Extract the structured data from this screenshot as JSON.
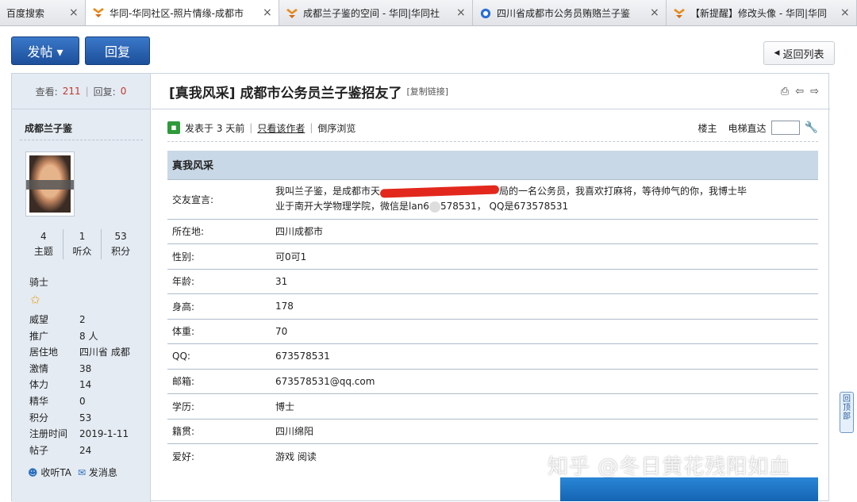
{
  "tabs": [
    {
      "title": "百度搜索",
      "active": false
    },
    {
      "title": "华同-华同社区-照片情缘-成都市",
      "active": true
    },
    {
      "title": "成都兰子鉴的空间 - 华同|华同社",
      "active": false
    },
    {
      "title": "四川省成都市公务员贿赂兰子鉴",
      "active": false
    },
    {
      "title": "【新提醒】修改头像 - 华同|华同",
      "active": false
    }
  ],
  "toolbar": {
    "post_label": "发帖 ▾",
    "reply_label": "回复",
    "back_label": "返回列表"
  },
  "sidebar": {
    "views_label": "查看:",
    "views_value": "211",
    "replies_label": "回复:",
    "replies_value": "0",
    "username": "成都兰子鉴",
    "stats": [
      {
        "value": "4",
        "label": "主题"
      },
      {
        "value": "1",
        "label": "听众"
      },
      {
        "value": "53",
        "label": "积分"
      }
    ],
    "rank": "骑士",
    "fields": [
      {
        "k": "威望",
        "v": "2"
      },
      {
        "k": "推广",
        "v": "8 人"
      },
      {
        "k": "居住地",
        "v": "四川省 成都"
      },
      {
        "k": "激情",
        "v": "38"
      },
      {
        "k": "体力",
        "v": "14"
      },
      {
        "k": "精华",
        "v": "0"
      },
      {
        "k": "积分",
        "v": "53"
      },
      {
        "k": "注册时间",
        "v": "2019-1-11"
      },
      {
        "k": "帖子",
        "v": "24"
      }
    ],
    "follow_label": "收听TA",
    "message_label": "发消息"
  },
  "post": {
    "title": "[真我风采] 成都市公务员兰子鉴招友了",
    "copy_label": "[复制链接]",
    "posted_label": "发表于 3 天前",
    "only_author_label": "只看该作者",
    "reverse_label": "倒序浏览",
    "floor_label": "楼主",
    "elevator_label": "电梯直达"
  },
  "table": {
    "heading": "真我风采",
    "declaration_key": "交友宣言:",
    "declaration_line1_a": "我叫兰子鉴，是成都市天",
    "declaration_line1_b": "局的一名公务员，我喜欢打麻将，等待帅气的你，我博士毕",
    "declaration_line2_a": "业于南开大学物理学院，微信是lan6",
    "declaration_line2_b": "578531，  QQ是673578531",
    "rows": [
      {
        "k": "所在地:",
        "v": "四川成都市"
      },
      {
        "k": "性别:",
        "v": "可0可1"
      },
      {
        "k": "年龄:",
        "v": "31"
      },
      {
        "k": "身高:",
        "v": "178"
      },
      {
        "k": "体重:",
        "v": "70"
      },
      {
        "k": "QQ:",
        "v": "673578531"
      },
      {
        "k": "邮箱:",
        "v": "673578531@qq.com"
      },
      {
        "k": "学历:",
        "v": "博士"
      },
      {
        "k": "籍贯:",
        "v": "四川绵阳"
      },
      {
        "k": "爱好:",
        "v": "游戏 阅读"
      }
    ]
  },
  "watermark": "知乎 @冬日黄花残阳如血",
  "back_to_top_label": "回顶部"
}
